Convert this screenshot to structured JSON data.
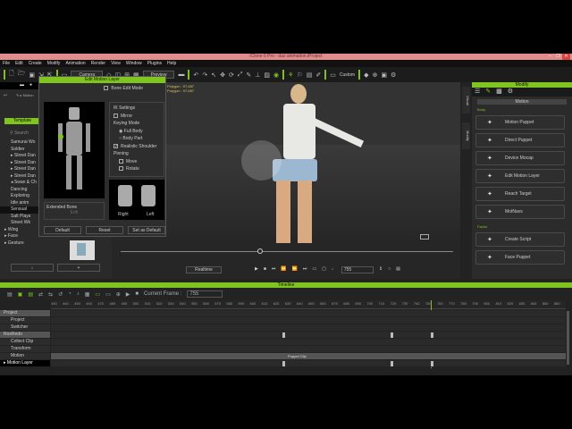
{
  "window": {
    "title": "iClone 6 Pro - daz animation.iProject",
    "controls": [
      "–",
      "❐",
      "✕"
    ]
  },
  "menu": [
    "File",
    "Edit",
    "Create",
    "Modify",
    "Animation",
    "Render",
    "View",
    "Window",
    "Plugins",
    "Help"
  ],
  "toolbar": {
    "camera_select": "Camera",
    "preview_select": "Preview",
    "custom_label": "Custom"
  },
  "left_panel": {
    "tab": "Template",
    "search_placeholder": "Search",
    "path": "Motion",
    "tree": [
      "Samurai Wo",
      "Soldier",
      "▸ Street Dan",
      "▸ Street Dan",
      "▸ Street Dan",
      "▸ Street Dan",
      "◂ Swan & Ch",
      "Dancing",
      "Exploring",
      "Idle anim",
      "Sensual",
      "Salt Plays",
      "Street Wk",
      "▸ Wing",
      "▸ Face",
      "▸ Gesture"
    ],
    "selected_index": 10
  },
  "dialog": {
    "title": "Edit Motion Layer",
    "bone_edit_mode": "Bone Edit Mode",
    "ik_settings": "IK Settings",
    "mirror": "Mirror",
    "keying_mode": "Keying Mode",
    "full_body": "Full Body",
    "body_part": "Body Part",
    "realistic_shoulder": "Realistic Shoulder",
    "pinning": "Pinning",
    "move": "Move",
    "rotate": "Rotate",
    "extended_bone": "Extended Bone",
    "edit": "Edit",
    "right": "Right",
    "left": "Left",
    "default": "Default",
    "reset": "Reset",
    "set_as_default": "Set as Default"
  },
  "viewport": {
    "info1": "Polygon : 97,687",
    "info2": "Polygon : 97,687"
  },
  "playback": {
    "realtime": "Realtime",
    "frame": "755",
    "slider_fraction": 0.42
  },
  "modify": {
    "title": "Modify",
    "section": "Motion",
    "group_body": "Body",
    "group_facial": "Facial",
    "side_tabs": [
      "Visual",
      "Modify"
    ],
    "buttons": [
      {
        "icon": "motion-puppet-icon",
        "label": "Motion Puppet"
      },
      {
        "icon": "direct-puppet-icon",
        "label": "Direct Puppet"
      },
      {
        "icon": "device-mocap-icon",
        "label": "Device Mocap"
      },
      {
        "icon": "edit-motion-layer-icon",
        "label": "Edit Motion Layer"
      },
      {
        "icon": "reach-target-icon",
        "label": "Reach Target"
      },
      {
        "icon": "motions-icon",
        "label": "MotNavs"
      }
    ],
    "facial_buttons": [
      {
        "icon": "create-script-icon",
        "label": "Create Script"
      },
      {
        "icon": "face-puppet-icon",
        "label": "Face Puppet"
      }
    ]
  },
  "timeline": {
    "title": "Timeline",
    "current_frame_label": "Current Frame :",
    "current_frame": "755",
    "ticks": [
      "430",
      "440",
      "450",
      "460",
      "470",
      "480",
      "490",
      "500",
      "510",
      "520",
      "530",
      "540",
      "550",
      "560",
      "570",
      "580",
      "590",
      "600",
      "610",
      "620",
      "630",
      "640",
      "650",
      "660",
      "670",
      "680",
      "690",
      "700",
      "710",
      "720",
      "730",
      "740",
      "750",
      "760",
      "770",
      "780",
      "790",
      "800",
      "810",
      "820",
      "830",
      "840",
      "850",
      "860"
    ],
    "tracks": [
      {
        "label": "Project",
        "group": true
      },
      {
        "label": "Project"
      },
      {
        "label": "Switcher"
      },
      {
        "label": "RoxRedo",
        "group": true
      },
      {
        "label": "Collect Clip"
      },
      {
        "label": "Transform"
      },
      {
        "label": "Motion"
      },
      {
        "label": "▸ Motion Layer"
      }
    ],
    "clip_label": "Puppet Clip"
  },
  "colors": {
    "accent": "#7fc41f",
    "titlebar": "#e28b8b"
  }
}
